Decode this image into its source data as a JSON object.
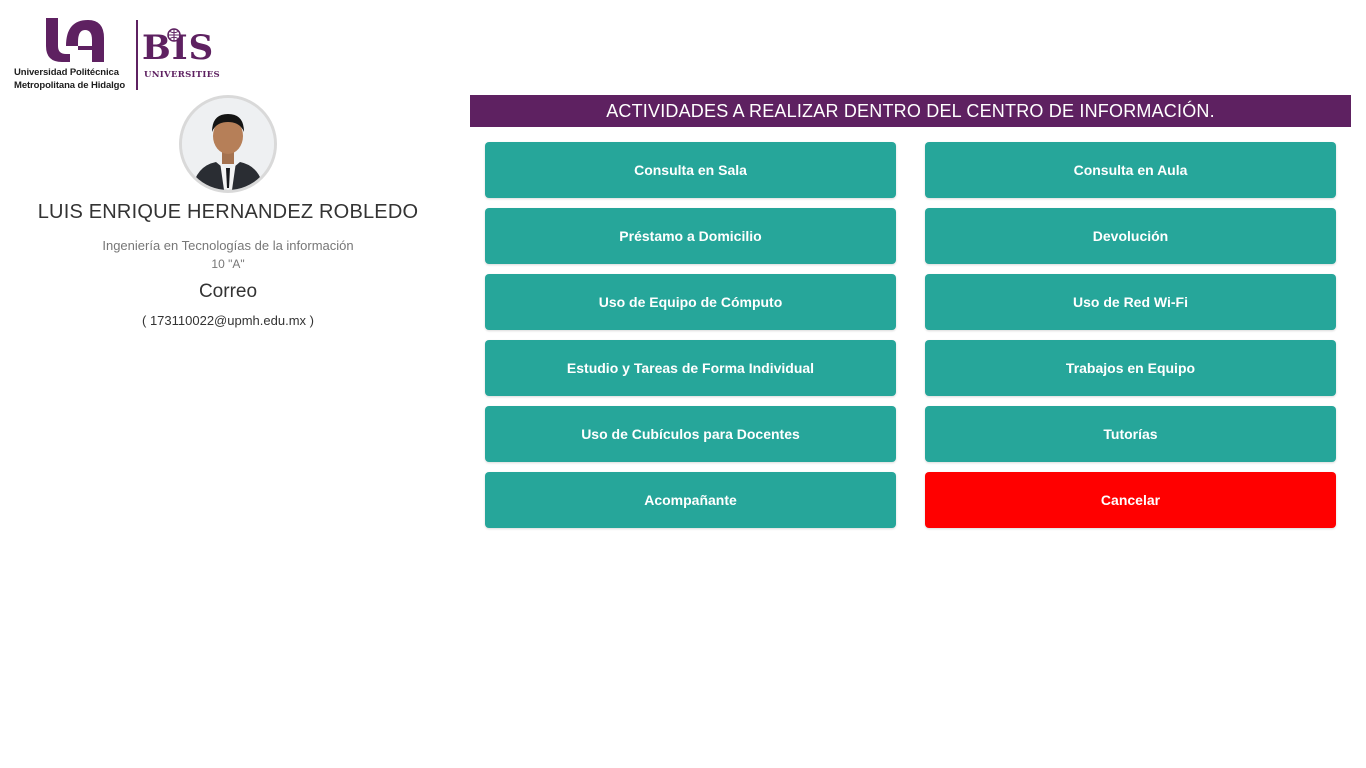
{
  "logo": {
    "university_line1": "Universidad Politécnica",
    "university_line2": "Metropolitana de Hidalgo",
    "bis_letters": "BIS",
    "bis_sub": "UNIVERSITIES"
  },
  "profile": {
    "name": "LUIS ENRIQUE HERNANDEZ ROBLEDO",
    "career": "Ingeniería en Tecnologías de la información",
    "group": "10 \"A\"",
    "email_title": "Correo",
    "email_value": "( 173110022@upmh.edu.mx )"
  },
  "activities": {
    "title": "ACTIVIDADES A REALIZAR DENTRO DEL CENTRO DE INFORMACIÓN.",
    "buttons": [
      {
        "label": "Consulta en Sala"
      },
      {
        "label": "Consulta en Aula"
      },
      {
        "label": "Préstamo a Domicilio"
      },
      {
        "label": "Devolución"
      },
      {
        "label": "Uso de Equipo de Cómputo"
      },
      {
        "label": "Uso de Red Wi-Fi"
      },
      {
        "label": "Estudio y Tareas de Forma Individual"
      },
      {
        "label": "Trabajos en Equipo"
      },
      {
        "label": "Uso de Cubículos para Docentes"
      },
      {
        "label": "Tutorías"
      },
      {
        "label": "Acompañante"
      },
      {
        "label": "Cancelar"
      }
    ]
  },
  "colors": {
    "brand_purple": "#5e2161",
    "button_teal": "#26a69a",
    "cancel_red": "#ff0000"
  }
}
